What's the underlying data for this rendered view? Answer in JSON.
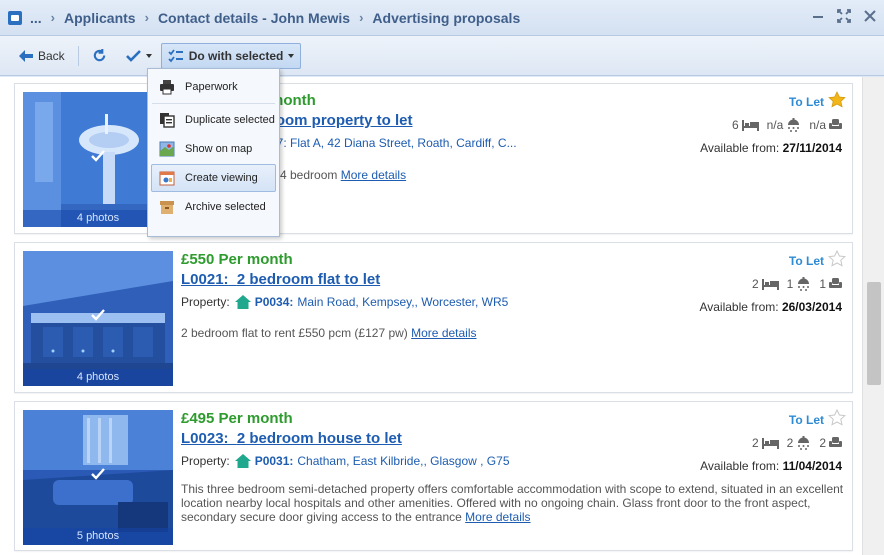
{
  "breadcrumbs": [
    "...",
    "Applicants",
    "Contact details - John Mewis",
    "Advertising proposals"
  ],
  "toolbar": {
    "back_label": "Back",
    "do_with_selected_label": "Do with selected"
  },
  "menu": {
    "items": [
      {
        "label": "Paperwork",
        "icon": "printer-icon"
      },
      {
        "label": "Duplicate selected",
        "icon": "duplicate-icon"
      },
      {
        "label": "Show on map",
        "icon": "map-icon"
      },
      {
        "label": "Create viewing",
        "icon": "calendar-icon"
      },
      {
        "label": "Archive selected",
        "icon": "archive-icon"
      }
    ]
  },
  "listings": [
    {
      "price": "£... Per month",
      "price_visible": "month",
      "ref_visible": "room property to let",
      "prop_visible": "87: Flat A, 42 Diana Street, Roath, Cardiff, C...",
      "desc_visible": "4 bedroom",
      "more_label": "More details",
      "status": "To Let",
      "starred": true,
      "beds": "6",
      "baths": "n/a",
      "receptions": "n/a",
      "available_label": "Available from:",
      "available_date": "27/11/2014",
      "photos": "4 photos"
    },
    {
      "price": "£550 Per month",
      "ref_code": "L0021:",
      "ref_title": "2 bedroom flat to let",
      "property_label": "Property:",
      "property_code": "P0034:",
      "property_address": "Main Road, Kempsey,, Worcester, WR5",
      "description": "2 bedroom flat to rent £550 pcm (£127 pw)",
      "more_label": "More details",
      "status": "To Let",
      "starred": false,
      "beds": "2",
      "baths": "1",
      "receptions": "1",
      "available_label": "Available from:",
      "available_date": "26/03/2014",
      "photos": "4 photos"
    },
    {
      "price": "£495 Per month",
      "ref_code": "L0023:",
      "ref_title": "2 bedroom house to let",
      "property_label": "Property:",
      "property_code": "P0031:",
      "property_address": "Chatham, East Kilbride,, Glasgow , G75",
      "description": "This three bedroom semi-detached property offers comfortable accommodation with scope to extend, situated in an excellent location nearby local hospitals and other amenities. Offered with no ongoing chain. Glass front door to the front aspect, secondary secure door giving access to the entrance",
      "more_label": "More details",
      "status": "To Let",
      "starred": false,
      "beds": "2",
      "baths": "2",
      "receptions": "2",
      "available_label": "Available from:",
      "available_date": "11/04/2014",
      "photos": "5 photos"
    }
  ],
  "colors": {
    "price_green": "#2e9b2e",
    "link_blue": "#1d5cb0",
    "status_blue": "#2e8bd3",
    "star_gold": "#f2b619"
  }
}
